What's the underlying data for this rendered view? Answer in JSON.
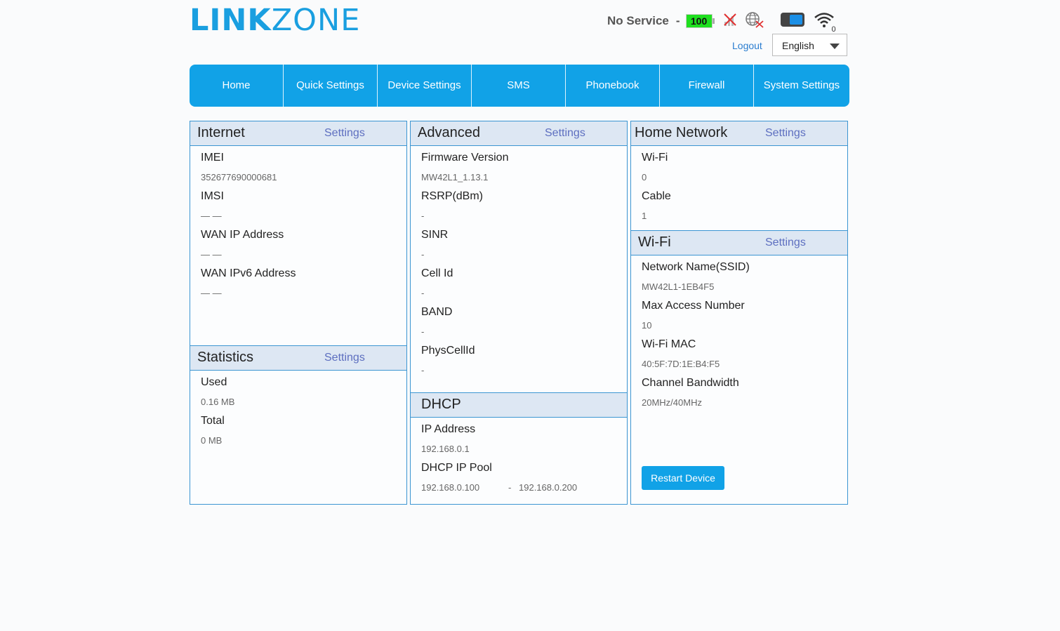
{
  "brand": {
    "bold": "LINK",
    "thin": "ZONE"
  },
  "status": {
    "network": "No Service",
    "separator": "-",
    "battery": "100",
    "wifi_count": "0"
  },
  "header": {
    "logout": "Logout",
    "language": "English"
  },
  "nav": [
    "Home",
    "Quick Settings",
    "Device Settings",
    "SMS",
    "Phonebook",
    "Firewall",
    "System Settings"
  ],
  "internet": {
    "title": "Internet",
    "settings": "Settings",
    "rows": [
      {
        "label": "IMEI",
        "value": "352677690000681"
      },
      {
        "label": "IMSI",
        "value": "— —"
      },
      {
        "label": "WAN IP Address",
        "value": "— —"
      },
      {
        "label": "WAN IPv6 Address",
        "value": "— —"
      }
    ]
  },
  "statistics": {
    "title": "Statistics",
    "settings": "Settings",
    "rows": [
      {
        "label": "Used",
        "value": "0.16 MB"
      },
      {
        "label": "Total",
        "value": "0 MB"
      }
    ]
  },
  "advanced": {
    "title": "Advanced",
    "settings": "Settings",
    "rows": [
      {
        "label": "Firmware Version",
        "value": "MW42L1_1.13.1"
      },
      {
        "label": "RSRP(dBm)",
        "value": "-"
      },
      {
        "label": "SINR",
        "value": "-"
      },
      {
        "label": "Cell Id",
        "value": "-"
      },
      {
        "label": "BAND",
        "value": "-"
      },
      {
        "label": "PhysCellId",
        "value": "-"
      }
    ]
  },
  "dhcp": {
    "title": "DHCP",
    "ip_label": "IP Address",
    "ip_value": "192.168.0.1",
    "pool_label": "DHCP IP Pool",
    "pool_start": "192.168.0.100",
    "pool_sep": "-",
    "pool_end": "192.168.0.200"
  },
  "home_network": {
    "title": "Home Network",
    "settings": "Settings",
    "rows": [
      {
        "label": "Wi-Fi",
        "value": "0"
      },
      {
        "label": "Cable",
        "value": "1"
      }
    ]
  },
  "wifi": {
    "title": "Wi-Fi",
    "settings": "Settings",
    "rows": [
      {
        "label": "Network Name(SSID)",
        "value": "MW42L1-1EB4F5"
      },
      {
        "label": "Max Access Number",
        "value": "10"
      },
      {
        "label": "Wi-Fi MAC",
        "value": "40:5F:7D:1E:B4:F5"
      },
      {
        "label": "Channel Bandwidth",
        "value": "20MHz/40MHz"
      }
    ],
    "restart": "Restart Device"
  },
  "colors": {
    "accent": "#11a2e7",
    "battery": "#1fe01f",
    "panel_head": "#dde7f3",
    "link": "#5d6fc0"
  }
}
